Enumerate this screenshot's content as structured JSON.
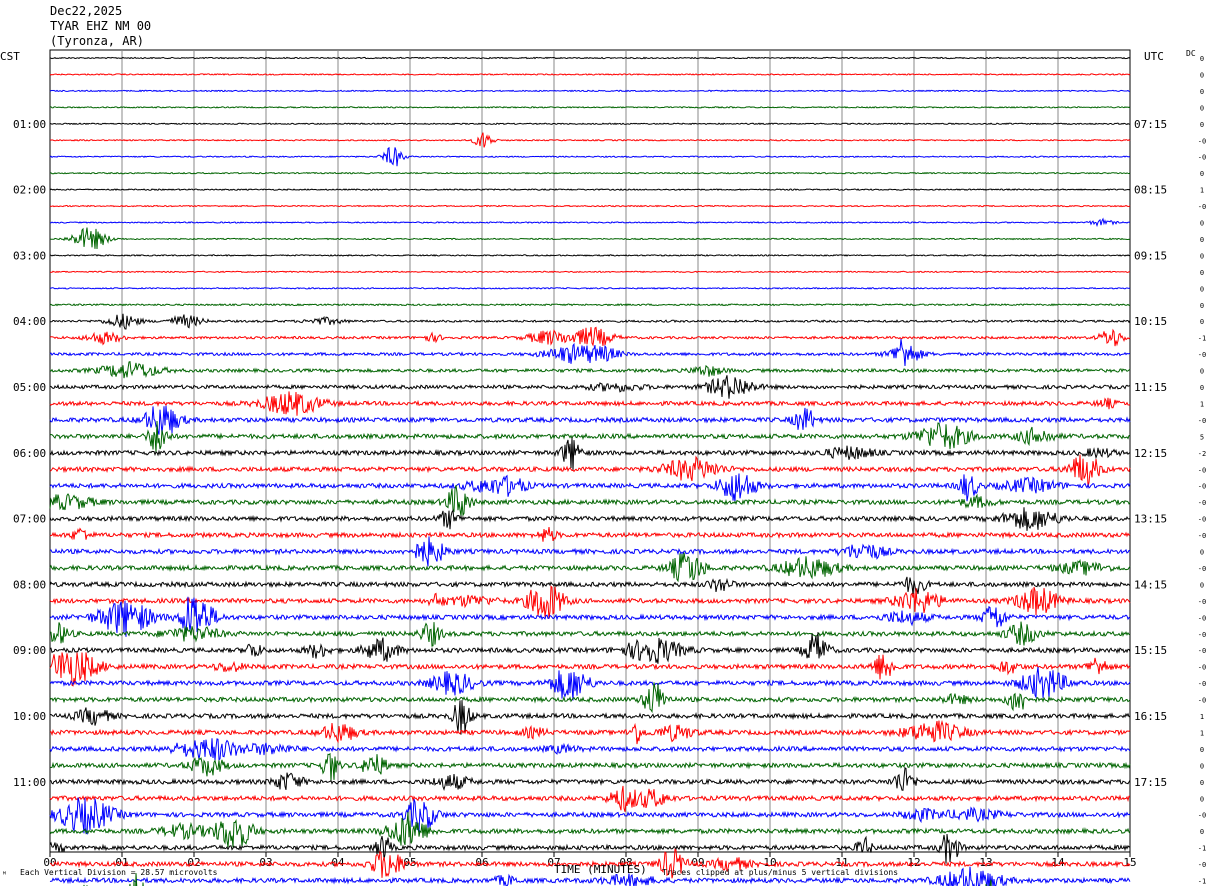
{
  "header": {
    "date": "Dec22,2025",
    "station": "TYAR EHZ NM 00",
    "location": "(Tyronza, AR)"
  },
  "left_axis_label": "CST",
  "right_axis_label": "UTC",
  "dc_label": "DC",
  "footer": {
    "scale_note": "Each Vertical Division =   28.57 microvolts",
    "x_axis_title": "TIME (MINUTES)",
    "clip_note": "Traces clipped at plus/minus 5 vertical divisions",
    "corner_mark": "ᴹ"
  },
  "chart_data": {
    "type": "line",
    "title": "",
    "xlabel": "TIME (MINUTES)",
    "xlim": [
      0,
      15
    ],
    "x_ticks": [
      "00",
      "01",
      "02",
      "03",
      "04",
      "05",
      "06",
      "07",
      "08",
      "09",
      "10",
      "11",
      "12",
      "13",
      "14",
      "15"
    ],
    "traces_per_hour": 4,
    "trace_minutes": 15,
    "trace_colors": [
      "#000000",
      "#ff0000",
      "#0000ff",
      "#006400"
    ],
    "left_hour_labels": [
      "01:00",
      "02:00",
      "03:00",
      "04:00",
      "05:00",
      "06:00",
      "07:00",
      "08:00",
      "09:00",
      "10:00",
      "11:00"
    ],
    "right_hour_labels": [
      "07:15",
      "08:15",
      "09:15",
      "10:15",
      "11:15",
      "12:15",
      "13:15",
      "14:15",
      "15:15",
      "16:15",
      "17:15"
    ],
    "dc_offsets": [
      "0",
      "0",
      "0",
      "0",
      "0",
      "-0",
      "-0",
      "0",
      "1",
      "-0",
      "0",
      "0",
      "0",
      "0",
      "0",
      "0",
      "0",
      "-1",
      "-0",
      "0",
      "0",
      "1",
      "-0",
      "5",
      "-2",
      "-0",
      "-0",
      "-0",
      "-0",
      "-0",
      "0",
      "-0",
      "0",
      "-0",
      "-0",
      "-0",
      "-0",
      "-0",
      "-0",
      "-0",
      "1",
      "1",
      "0",
      "0",
      "0",
      "0",
      "-0",
      "0",
      "-1",
      "-0",
      "-1",
      "0"
    ],
    "grid": true
  }
}
